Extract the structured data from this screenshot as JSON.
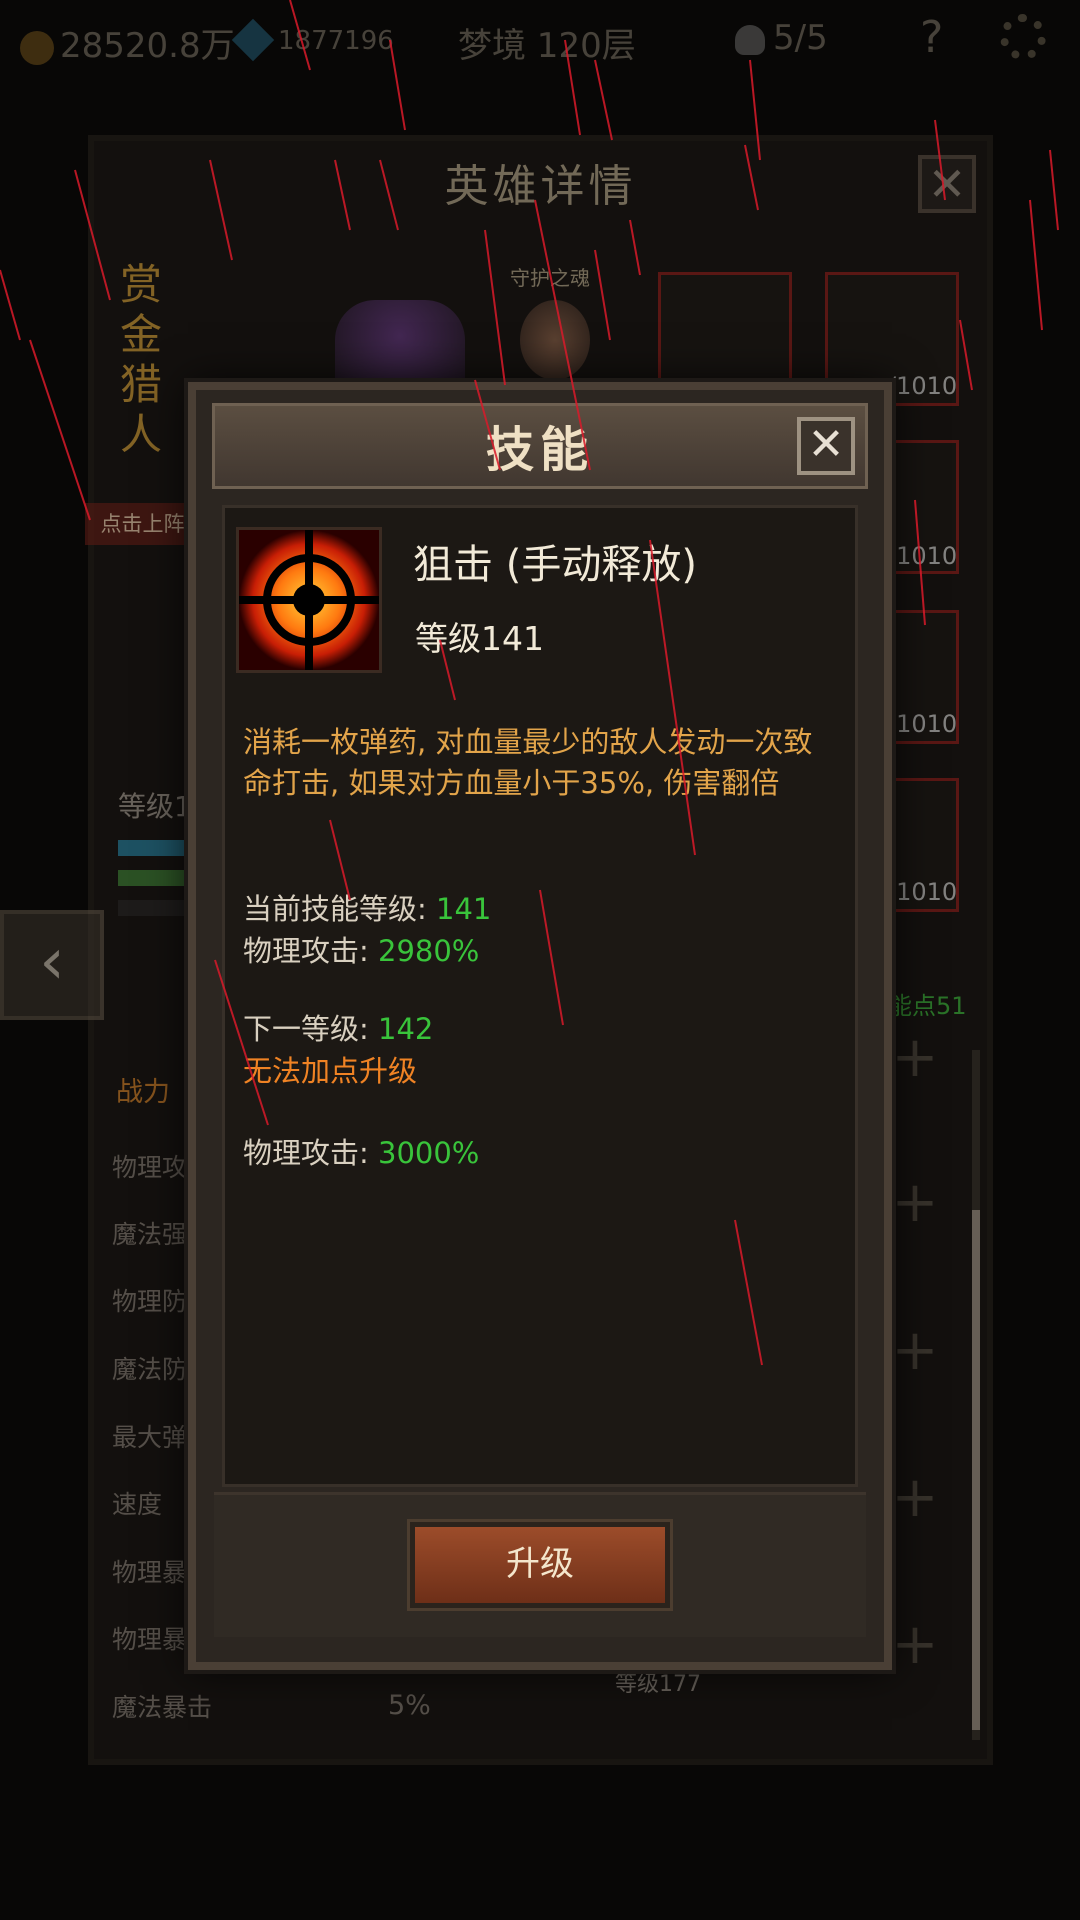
{
  "topbar": {
    "gold": "28520.8万",
    "gems": "1877196",
    "dream_realm": "梦境 120层",
    "stamina": "5/5",
    "help": "?"
  },
  "hero_panel": {
    "title": "英雄详情",
    "close": "✕",
    "hero_name": "赏金猎人",
    "guard_label": "守护之魂",
    "deploy_button": "点击上阵",
    "level_label": "等级1",
    "slot_labels": [
      "/1010",
      "/1010",
      "/1010",
      "/1010"
    ],
    "power_label": "战力",
    "stats": [
      "物理攻",
      "魔法强",
      "物理防",
      "魔法防",
      "最大弹",
      "速度",
      "物理暴",
      "物理暴",
      "魔法暴击"
    ],
    "last_stat_value": "5%",
    "skill_points": "能点51",
    "bottom_level": "等级177",
    "prev_arrow": "‹"
  },
  "skill_dialog": {
    "title": "技能",
    "close": "✕",
    "skill_name": "狙击 (手动释放)",
    "skill_level": "等级141",
    "description": "消耗一枚弹药, 对血量最少的敌人发动一次致命打击, 如果对方血量小于35%, 伤害翻倍",
    "current_level_label": "当前技能等级: ",
    "current_level_value": "141",
    "physical_attack_label": "物理攻击: ",
    "physical_attack_value": "2980%",
    "next_level_label": "下一等级: ",
    "next_level_value": "142",
    "cannot_upgrade": "无法加点升级",
    "next_attack_label": "物理攻击: ",
    "next_attack_value": "3000%",
    "upgrade_button": "升级",
    "skill_icon": "crosshair-icon"
  },
  "colors": {
    "gold_text": "#e2a44a",
    "green_value": "#39c43b",
    "warning_orange": "#f08324",
    "rain": "#d81a2a"
  }
}
